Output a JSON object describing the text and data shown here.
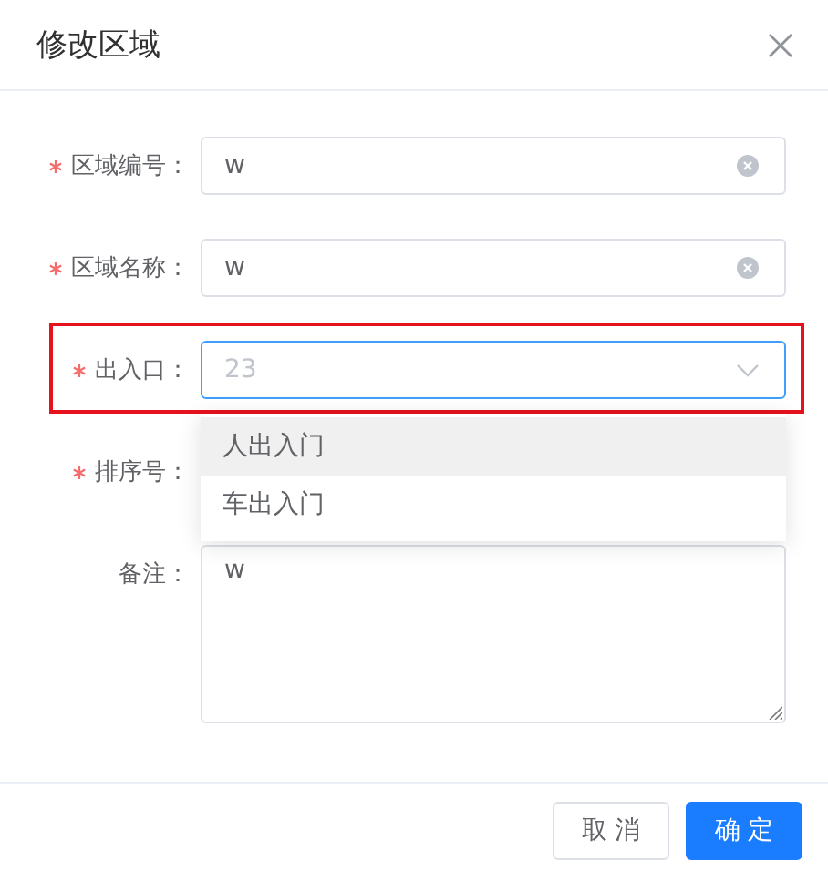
{
  "dialog": {
    "title": "修改区域"
  },
  "fields": [
    {
      "kind": "input",
      "label": "区域编号：",
      "required": true,
      "value": "w",
      "clearable": true
    },
    {
      "kind": "input",
      "label": "区域名称：",
      "required": true,
      "value": "w",
      "clearable": true
    },
    {
      "kind": "select",
      "label": "出入口：",
      "required": true,
      "placeholder": "23",
      "focused": true,
      "highlighted": true,
      "options": [
        {
          "label": "人出入门",
          "hovered": true
        },
        {
          "label": "车出入门",
          "hovered": false
        }
      ]
    },
    {
      "kind": "covered",
      "label": "排序号：",
      "required": true
    },
    {
      "kind": "textarea",
      "label": "备注：",
      "required": false,
      "value": "w"
    }
  ],
  "buttons": [
    {
      "label": "取 消",
      "kind": "default"
    },
    {
      "label": "确 定",
      "kind": "primary"
    }
  ]
}
